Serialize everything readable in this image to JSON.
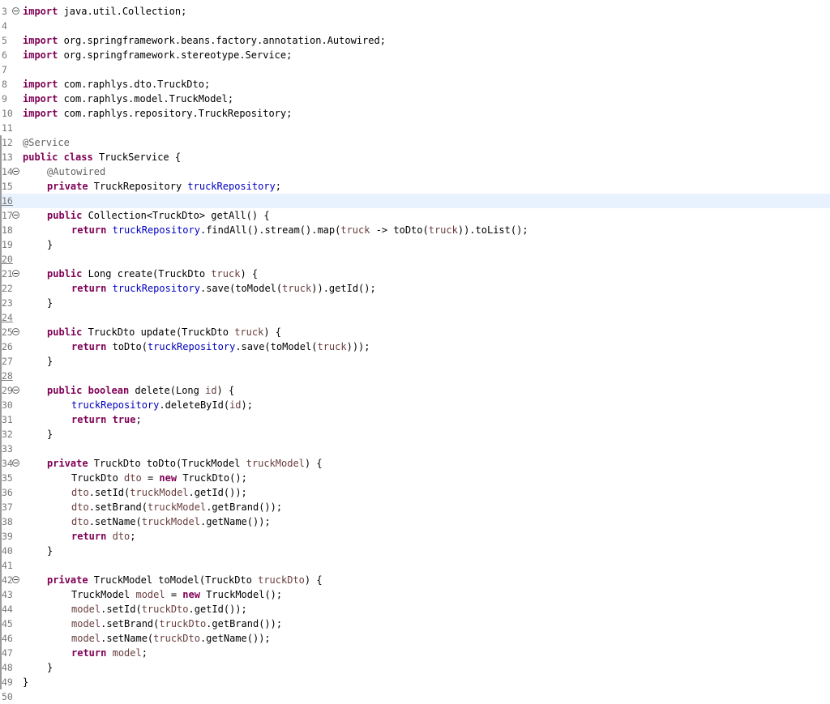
{
  "editor": {
    "current_line_index": 13,
    "lines": [
      {
        "n": "3",
        "fold": true,
        "changed": false,
        "underlined": false,
        "indent": 0,
        "tokens": [
          {
            "t": "kw",
            "v": "import"
          },
          {
            "t": "txt",
            "v": " java.util.Collection;"
          }
        ]
      },
      {
        "n": "4",
        "fold": false,
        "changed": false,
        "underlined": false,
        "indent": 0,
        "tokens": []
      },
      {
        "n": "5",
        "fold": false,
        "changed": false,
        "underlined": false,
        "indent": 0,
        "tokens": [
          {
            "t": "kw",
            "v": "import"
          },
          {
            "t": "txt",
            "v": " org.springframework.beans.factory.annotation.Autowired;"
          }
        ]
      },
      {
        "n": "6",
        "fold": false,
        "changed": false,
        "underlined": false,
        "indent": 0,
        "tokens": [
          {
            "t": "kw",
            "v": "import"
          },
          {
            "t": "txt",
            "v": " org.springframework.stereotype.Service;"
          }
        ]
      },
      {
        "n": "7",
        "fold": false,
        "changed": false,
        "underlined": false,
        "indent": 0,
        "tokens": []
      },
      {
        "n": "8",
        "fold": false,
        "changed": false,
        "underlined": false,
        "indent": 0,
        "tokens": [
          {
            "t": "kw",
            "v": "import"
          },
          {
            "t": "txt",
            "v": " com.raphlys.dto.TruckDto;"
          }
        ]
      },
      {
        "n": "9",
        "fold": false,
        "changed": false,
        "underlined": false,
        "indent": 0,
        "tokens": [
          {
            "t": "kw",
            "v": "import"
          },
          {
            "t": "txt",
            "v": " com.raphlys.model.TruckModel;"
          }
        ]
      },
      {
        "n": "10",
        "fold": false,
        "changed": false,
        "underlined": false,
        "indent": 0,
        "tokens": [
          {
            "t": "kw",
            "v": "import"
          },
          {
            "t": "txt",
            "v": " com.raphlys.repository.TruckRepository;"
          }
        ]
      },
      {
        "n": "11",
        "fold": false,
        "changed": false,
        "underlined": false,
        "indent": 0,
        "tokens": []
      },
      {
        "n": "12",
        "fold": false,
        "changed": true,
        "underlined": false,
        "indent": 0,
        "tokens": [
          {
            "t": "ann",
            "v": "@Service"
          }
        ]
      },
      {
        "n": "13",
        "fold": false,
        "changed": true,
        "underlined": false,
        "indent": 0,
        "tokens": [
          {
            "t": "kw",
            "v": "public"
          },
          {
            "t": "txt",
            "v": " "
          },
          {
            "t": "kw",
            "v": "class"
          },
          {
            "t": "txt",
            "v": " TruckService {"
          }
        ]
      },
      {
        "n": "14",
        "fold": true,
        "changed": true,
        "underlined": false,
        "indent": 1,
        "tokens": [
          {
            "t": "ann",
            "v": "@Autowired"
          }
        ]
      },
      {
        "n": "15",
        "fold": false,
        "changed": true,
        "underlined": false,
        "indent": 1,
        "tokens": [
          {
            "t": "kw",
            "v": "private"
          },
          {
            "t": "txt",
            "v": " TruckRepository "
          },
          {
            "t": "fld",
            "v": "truckRepository"
          },
          {
            "t": "txt",
            "v": ";"
          }
        ]
      },
      {
        "n": "16",
        "fold": false,
        "changed": true,
        "underlined": true,
        "indent": 0,
        "tokens": []
      },
      {
        "n": "17",
        "fold": true,
        "changed": true,
        "underlined": false,
        "indent": 1,
        "tokens": [
          {
            "t": "kw",
            "v": "public"
          },
          {
            "t": "txt",
            "v": " Collection<TruckDto> getAll() {"
          }
        ]
      },
      {
        "n": "18",
        "fold": false,
        "changed": true,
        "underlined": false,
        "indent": 2,
        "tokens": [
          {
            "t": "kw",
            "v": "return"
          },
          {
            "t": "txt",
            "v": " "
          },
          {
            "t": "fld",
            "v": "truckRepository"
          },
          {
            "t": "txt",
            "v": ".findAll().stream().map("
          },
          {
            "t": "var",
            "v": "truck"
          },
          {
            "t": "txt",
            "v": " -> toDto("
          },
          {
            "t": "var",
            "v": "truck"
          },
          {
            "t": "txt",
            "v": ")).toList();"
          }
        ]
      },
      {
        "n": "19",
        "fold": false,
        "changed": true,
        "underlined": false,
        "indent": 1,
        "tokens": [
          {
            "t": "txt",
            "v": "}"
          }
        ]
      },
      {
        "n": "20",
        "fold": false,
        "changed": true,
        "underlined": true,
        "indent": 0,
        "tokens": []
      },
      {
        "n": "21",
        "fold": true,
        "changed": true,
        "underlined": false,
        "indent": 1,
        "tokens": [
          {
            "t": "kw",
            "v": "public"
          },
          {
            "t": "txt",
            "v": " Long create(TruckDto "
          },
          {
            "t": "var",
            "v": "truck"
          },
          {
            "t": "txt",
            "v": ") {"
          }
        ]
      },
      {
        "n": "22",
        "fold": false,
        "changed": true,
        "underlined": false,
        "indent": 2,
        "tokens": [
          {
            "t": "kw",
            "v": "return"
          },
          {
            "t": "txt",
            "v": " "
          },
          {
            "t": "fld",
            "v": "truckRepository"
          },
          {
            "t": "txt",
            "v": ".save(toModel("
          },
          {
            "t": "var",
            "v": "truck"
          },
          {
            "t": "txt",
            "v": ")).getId();"
          }
        ]
      },
      {
        "n": "23",
        "fold": false,
        "changed": true,
        "underlined": false,
        "indent": 1,
        "tokens": [
          {
            "t": "txt",
            "v": "}"
          }
        ]
      },
      {
        "n": "24",
        "fold": false,
        "changed": true,
        "underlined": true,
        "indent": 0,
        "tokens": []
      },
      {
        "n": "25",
        "fold": true,
        "changed": true,
        "underlined": false,
        "indent": 1,
        "tokens": [
          {
            "t": "kw",
            "v": "public"
          },
          {
            "t": "txt",
            "v": " TruckDto update(TruckDto "
          },
          {
            "t": "var",
            "v": "truck"
          },
          {
            "t": "txt",
            "v": ") {"
          }
        ]
      },
      {
        "n": "26",
        "fold": false,
        "changed": true,
        "underlined": false,
        "indent": 2,
        "tokens": [
          {
            "t": "kw",
            "v": "return"
          },
          {
            "t": "txt",
            "v": " toDto("
          },
          {
            "t": "fld",
            "v": "truckRepository"
          },
          {
            "t": "txt",
            "v": ".save(toModel("
          },
          {
            "t": "var",
            "v": "truck"
          },
          {
            "t": "txt",
            "v": ")));"
          }
        ]
      },
      {
        "n": "27",
        "fold": false,
        "changed": true,
        "underlined": false,
        "indent": 1,
        "tokens": [
          {
            "t": "txt",
            "v": "}"
          }
        ]
      },
      {
        "n": "28",
        "fold": false,
        "changed": true,
        "underlined": true,
        "indent": 0,
        "tokens": []
      },
      {
        "n": "29",
        "fold": true,
        "changed": true,
        "underlined": false,
        "indent": 1,
        "tokens": [
          {
            "t": "kw",
            "v": "public"
          },
          {
            "t": "txt",
            "v": " "
          },
          {
            "t": "kw",
            "v": "boolean"
          },
          {
            "t": "txt",
            "v": " delete(Long "
          },
          {
            "t": "var",
            "v": "id"
          },
          {
            "t": "txt",
            "v": ") {"
          }
        ]
      },
      {
        "n": "30",
        "fold": false,
        "changed": true,
        "underlined": false,
        "indent": 2,
        "tokens": [
          {
            "t": "fld",
            "v": "truckRepository"
          },
          {
            "t": "txt",
            "v": ".deleteById("
          },
          {
            "t": "var",
            "v": "id"
          },
          {
            "t": "txt",
            "v": ");"
          }
        ]
      },
      {
        "n": "31",
        "fold": false,
        "changed": true,
        "underlined": false,
        "indent": 2,
        "tokens": [
          {
            "t": "kw",
            "v": "return"
          },
          {
            "t": "txt",
            "v": " "
          },
          {
            "t": "kw",
            "v": "true"
          },
          {
            "t": "txt",
            "v": ";"
          }
        ]
      },
      {
        "n": "32",
        "fold": false,
        "changed": true,
        "underlined": false,
        "indent": 1,
        "tokens": [
          {
            "t": "txt",
            "v": "}"
          }
        ]
      },
      {
        "n": "33",
        "fold": false,
        "changed": true,
        "underlined": false,
        "indent": 0,
        "tokens": []
      },
      {
        "n": "34",
        "fold": true,
        "changed": true,
        "underlined": false,
        "indent": 1,
        "tokens": [
          {
            "t": "kw",
            "v": "private"
          },
          {
            "t": "txt",
            "v": " TruckDto toDto(TruckModel "
          },
          {
            "t": "var",
            "v": "truckModel"
          },
          {
            "t": "txt",
            "v": ") {"
          }
        ]
      },
      {
        "n": "35",
        "fold": false,
        "changed": true,
        "underlined": false,
        "indent": 2,
        "tokens": [
          {
            "t": "txt",
            "v": "TruckDto "
          },
          {
            "t": "var",
            "v": "dto"
          },
          {
            "t": "txt",
            "v": " = "
          },
          {
            "t": "kw",
            "v": "new"
          },
          {
            "t": "txt",
            "v": " TruckDto();"
          }
        ]
      },
      {
        "n": "36",
        "fold": false,
        "changed": true,
        "underlined": false,
        "indent": 2,
        "tokens": [
          {
            "t": "var",
            "v": "dto"
          },
          {
            "t": "txt",
            "v": ".setId("
          },
          {
            "t": "var",
            "v": "truckModel"
          },
          {
            "t": "txt",
            "v": ".getId());"
          }
        ]
      },
      {
        "n": "37",
        "fold": false,
        "changed": true,
        "underlined": false,
        "indent": 2,
        "tokens": [
          {
            "t": "var",
            "v": "dto"
          },
          {
            "t": "txt",
            "v": ".setBrand("
          },
          {
            "t": "var",
            "v": "truckModel"
          },
          {
            "t": "txt",
            "v": ".getBrand());"
          }
        ]
      },
      {
        "n": "38",
        "fold": false,
        "changed": true,
        "underlined": false,
        "indent": 2,
        "tokens": [
          {
            "t": "var",
            "v": "dto"
          },
          {
            "t": "txt",
            "v": ".setName("
          },
          {
            "t": "var",
            "v": "truckModel"
          },
          {
            "t": "txt",
            "v": ".getName());"
          }
        ]
      },
      {
        "n": "39",
        "fold": false,
        "changed": true,
        "underlined": false,
        "indent": 2,
        "tokens": [
          {
            "t": "kw",
            "v": "return"
          },
          {
            "t": "txt",
            "v": " "
          },
          {
            "t": "var",
            "v": "dto"
          },
          {
            "t": "txt",
            "v": ";"
          }
        ]
      },
      {
        "n": "40",
        "fold": false,
        "changed": true,
        "underlined": false,
        "indent": 1,
        "tokens": [
          {
            "t": "txt",
            "v": "}"
          }
        ]
      },
      {
        "n": "41",
        "fold": false,
        "changed": true,
        "underlined": false,
        "indent": 0,
        "tokens": []
      },
      {
        "n": "42",
        "fold": true,
        "changed": true,
        "underlined": false,
        "indent": 1,
        "tokens": [
          {
            "t": "kw",
            "v": "private"
          },
          {
            "t": "txt",
            "v": " TruckModel toModel(TruckDto "
          },
          {
            "t": "var",
            "v": "truckDto"
          },
          {
            "t": "txt",
            "v": ") {"
          }
        ]
      },
      {
        "n": "43",
        "fold": false,
        "changed": true,
        "underlined": false,
        "indent": 2,
        "tokens": [
          {
            "t": "txt",
            "v": "TruckModel "
          },
          {
            "t": "var",
            "v": "model"
          },
          {
            "t": "txt",
            "v": " = "
          },
          {
            "t": "kw",
            "v": "new"
          },
          {
            "t": "txt",
            "v": " TruckModel();"
          }
        ]
      },
      {
        "n": "44",
        "fold": false,
        "changed": true,
        "underlined": false,
        "indent": 2,
        "tokens": [
          {
            "t": "var",
            "v": "model"
          },
          {
            "t": "txt",
            "v": ".setId("
          },
          {
            "t": "var",
            "v": "truckDto"
          },
          {
            "t": "txt",
            "v": ".getId());"
          }
        ]
      },
      {
        "n": "45",
        "fold": false,
        "changed": true,
        "underlined": false,
        "indent": 2,
        "tokens": [
          {
            "t": "var",
            "v": "model"
          },
          {
            "t": "txt",
            "v": ".setBrand("
          },
          {
            "t": "var",
            "v": "truckDto"
          },
          {
            "t": "txt",
            "v": ".getBrand());"
          }
        ]
      },
      {
        "n": "46",
        "fold": false,
        "changed": true,
        "underlined": false,
        "indent": 2,
        "tokens": [
          {
            "t": "var",
            "v": "model"
          },
          {
            "t": "txt",
            "v": ".setName("
          },
          {
            "t": "var",
            "v": "truckDto"
          },
          {
            "t": "txt",
            "v": ".getName());"
          }
        ]
      },
      {
        "n": "47",
        "fold": false,
        "changed": true,
        "underlined": false,
        "indent": 2,
        "tokens": [
          {
            "t": "kw",
            "v": "return"
          },
          {
            "t": "txt",
            "v": " "
          },
          {
            "t": "var",
            "v": "model"
          },
          {
            "t": "txt",
            "v": ";"
          }
        ]
      },
      {
        "n": "48",
        "fold": false,
        "changed": true,
        "underlined": false,
        "indent": 1,
        "tokens": [
          {
            "t": "txt",
            "v": "}"
          }
        ]
      },
      {
        "n": "49",
        "fold": false,
        "changed": true,
        "underlined": false,
        "indent": 0,
        "tokens": [
          {
            "t": "txt",
            "v": "}"
          }
        ]
      },
      {
        "n": "50",
        "fold": false,
        "changed": false,
        "underlined": false,
        "indent": 0,
        "tokens": []
      }
    ]
  }
}
